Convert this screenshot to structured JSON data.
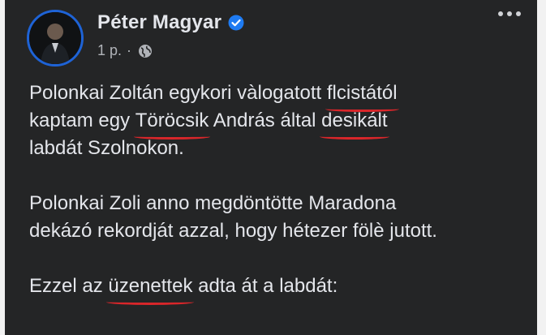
{
  "post": {
    "author": "Péter Magyar",
    "time": "1 p.",
    "separator": "·",
    "verified_icon": "verified-badge-icon",
    "privacy_icon": "globe-icon",
    "menu_icon": "more-options-icon",
    "accent_color": "#1e63d6",
    "underline_color": "#d9262a",
    "paragraphs": {
      "p1": {
        "a": "Polonkai Zoltán egykori vàlogatott ",
        "u1": "flcistától",
        "b": "kaptam egy ",
        "u2": "Töröcsik",
        "c": " András által ",
        "u3": "desikált",
        "d": "labdát Szolnokon."
      },
      "p2": {
        "a": "Polonkai Zoli anno megdöntötte Maradona",
        "b": "dekázó rekordját azzal, hogy hétezer fölè jutott."
      },
      "p3": {
        "a": "Ezzel az ",
        "u1": "üzenettek",
        "b": " adta át a labdát:"
      }
    }
  }
}
